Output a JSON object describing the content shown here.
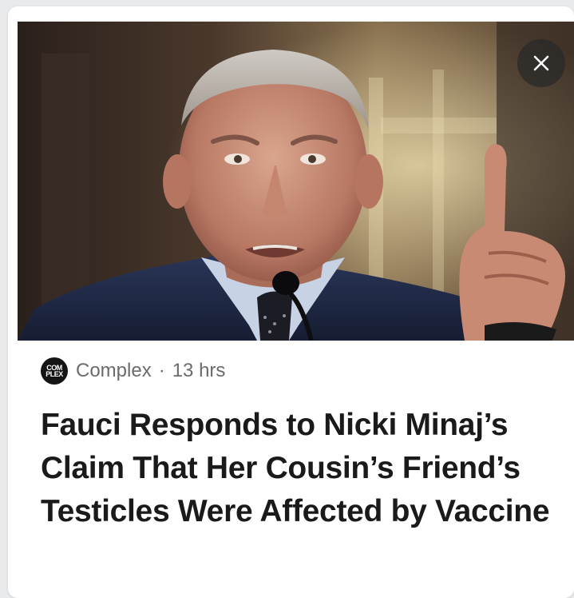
{
  "article": {
    "source": {
      "logo_text_top": "COM",
      "logo_text_bottom": "PLEX",
      "name": "Complex",
      "separator": "·",
      "time_ago": "13 hrs"
    },
    "headline": "Fauci Responds to Nicki Minaj’s Claim That Her Cousin’s Friend’s Testicles Were Affected by Vaccine",
    "image": {
      "icon": "photo-of-speaker-at-microphone"
    }
  },
  "controls": {
    "close_icon": "close-icon"
  },
  "colors": {
    "card_background": "#ffffff",
    "page_background": "#e9eaec",
    "meta_text": "#6b6b6b",
    "headline_text": "#1a1a1a",
    "suit": "#1f2a44",
    "backdrop": "#3a2c24"
  }
}
